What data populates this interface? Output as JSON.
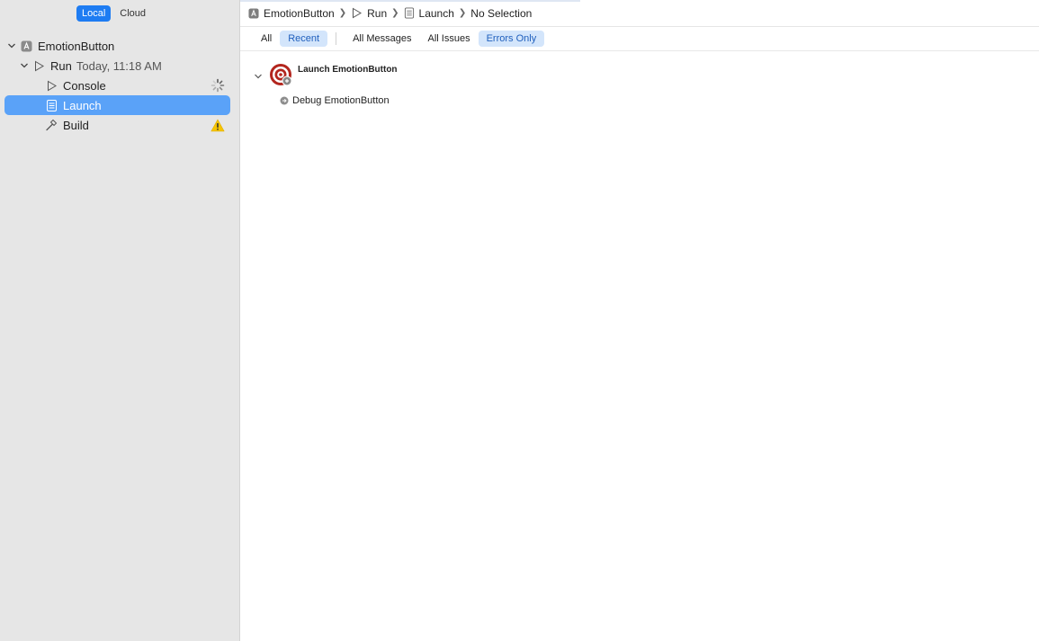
{
  "sidebar": {
    "scope": {
      "local_label": "Local",
      "cloud_label": "Cloud"
    },
    "tree": {
      "project": {
        "label": "EmotionButton",
        "icon": "app-project-icon"
      },
      "run": {
        "label": "Run",
        "timestamp": "Today, 11:18 AM",
        "icon": "play-icon"
      },
      "console": {
        "label": "Console",
        "icon": "play-icon",
        "status_icon": "activity-spinner-icon"
      },
      "launch": {
        "label": "Launch",
        "icon": "document-log-icon",
        "selected": true
      },
      "build": {
        "label": "Build",
        "icon": "hammer-icon",
        "status_icon": "warning-icon"
      }
    }
  },
  "breadcrumb": {
    "items": [
      {
        "label": "EmotionButton",
        "icon": "app-project-icon"
      },
      {
        "label": "Run",
        "icon": "play-icon"
      },
      {
        "label": "Launch",
        "icon": "document-log-icon"
      },
      {
        "label": "No Selection"
      }
    ],
    "separator": "❯"
  },
  "filters": {
    "all": "All",
    "recent": "Recent",
    "all_messages": "All Messages",
    "all_issues": "All Issues",
    "errors_only": "Errors Only"
  },
  "log": {
    "group_title": "Launch EmotionButton",
    "group_icon": "target-debug-icon",
    "child_label": "Debug EmotionButton",
    "child_icon": "arrow-circle-icon"
  },
  "colors": {
    "accent": "#1e7cf2",
    "selection": "#5aa2f8",
    "warning": "#f5c400",
    "target_red": "#b3261e"
  }
}
